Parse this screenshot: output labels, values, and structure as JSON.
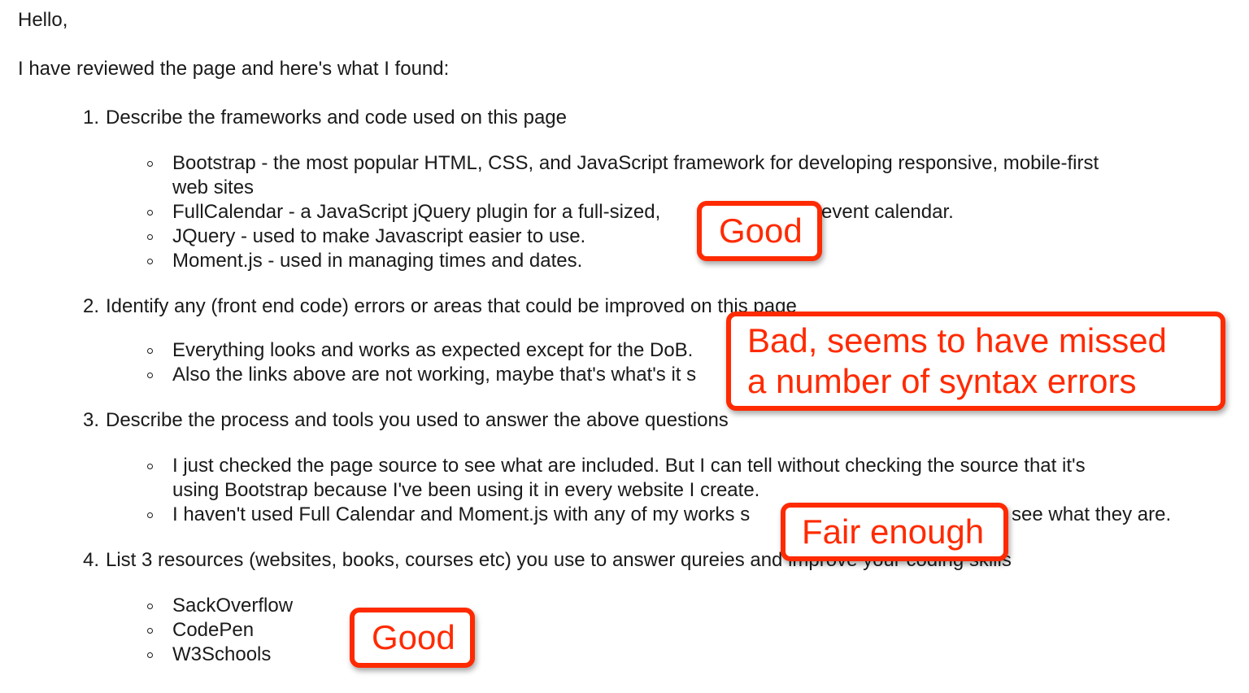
{
  "email": {
    "greeting": "Hello,",
    "intro": "I have reviewed the page and here's what I found:",
    "sections": [
      {
        "number": "1.",
        "heading": "Describe the frameworks and code used on this page",
        "bullets": [
          "Bootstrap - the most popular HTML, CSS, and JavaScript framework for developing responsive, mobile-first",
          "web sites",
          "FullCalendar - a JavaScript jQuery plugin for a full-sized,",
          "event calendar.",
          "JQuery - used to make Javascript easier to use.",
          "Moment.js - used in managing times and dates."
        ]
      },
      {
        "number": "2.",
        "heading": "Identify any (front end code) errors or areas that could be improved on this page",
        "bullets": [
          "Everything looks and works as expected except for the DoB.",
          "Also the links above are not working, maybe that's what's it s"
        ]
      },
      {
        "number": "3.",
        "heading": "Describe the process and tools you used to answer the above questions",
        "bullets": [
          "I just checked the page source to see what are included. But I can tell without checking the source that it's",
          "using Bootstrap because I've been using it in every website I create.",
          "I haven't used Full Calendar and Moment.js with any of my works s",
          "see what they are."
        ]
      },
      {
        "number": "4.",
        "heading": "List 3 resources (websites, books, courses etc) you use to answer qureies and improve your coding skills",
        "bullets": [
          "SackOverflow",
          "CodePen",
          "W3Schools"
        ]
      }
    ]
  },
  "annotations": {
    "good_1": "Good",
    "bad_line1": "Bad, seems to have missed",
    "bad_line2": "a number of syntax errors",
    "fair": "Fair enough",
    "good_2": "Good"
  },
  "colors": {
    "annotation": "#ff2a00",
    "text": "#1a1a1a"
  }
}
